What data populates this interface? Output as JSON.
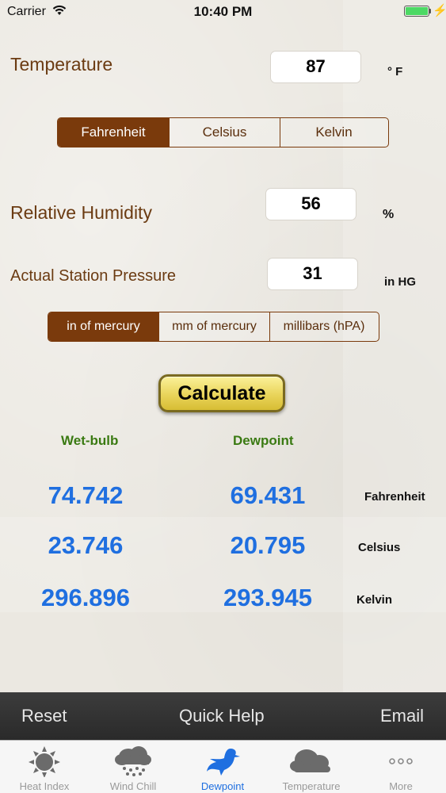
{
  "status_bar": {
    "carrier": "Carrier",
    "time": "10:40 PM",
    "charging_symbol": "⚡"
  },
  "temperature": {
    "label": "Temperature",
    "value": "87",
    "unit": "° F",
    "scale_options": [
      "Fahrenheit",
      "Celsius",
      "Kelvin"
    ],
    "selected": "Fahrenheit"
  },
  "humidity": {
    "label": "Relative Humidity",
    "value": "56",
    "unit": "%"
  },
  "pressure": {
    "label": "Actual Station Pressure",
    "value": "31",
    "unit": "in HG",
    "unit_options": [
      "in of mercury",
      "mm of mercury",
      "millibars (hPA)"
    ],
    "selected": "in of mercury"
  },
  "calculate_label": "Calculate",
  "results": {
    "headers": {
      "wetbulb": "Wet-bulb",
      "dewpoint": "Dewpoint"
    },
    "rows": [
      {
        "unit": "Fahrenheit",
        "wetbulb": "74.742",
        "dewpoint": "69.431"
      },
      {
        "unit": "Celsius",
        "wetbulb": "23.746",
        "dewpoint": "20.795"
      },
      {
        "unit": "Kelvin",
        "wetbulb": "296.896",
        "dewpoint": "293.945"
      }
    ]
  },
  "toolbar": {
    "reset": "Reset",
    "help": "Quick Help",
    "email": "Email"
  },
  "tabs": [
    {
      "label": "Heat Index",
      "icon": "sun-icon",
      "active": false
    },
    {
      "label": "Wind Chill",
      "icon": "snow-cloud-icon",
      "active": false
    },
    {
      "label": "Dewpoint",
      "icon": "bird-icon",
      "active": true
    },
    {
      "label": "Temperature",
      "icon": "cloud-icon",
      "active": false
    },
    {
      "label": "More",
      "icon": "more-icon",
      "active": false
    }
  ],
  "colors": {
    "accent_brown": "#7a3a0c",
    "result_blue": "#1f6fe0",
    "header_green": "#3a7a12",
    "active_tab": "#1f6fe0"
  }
}
